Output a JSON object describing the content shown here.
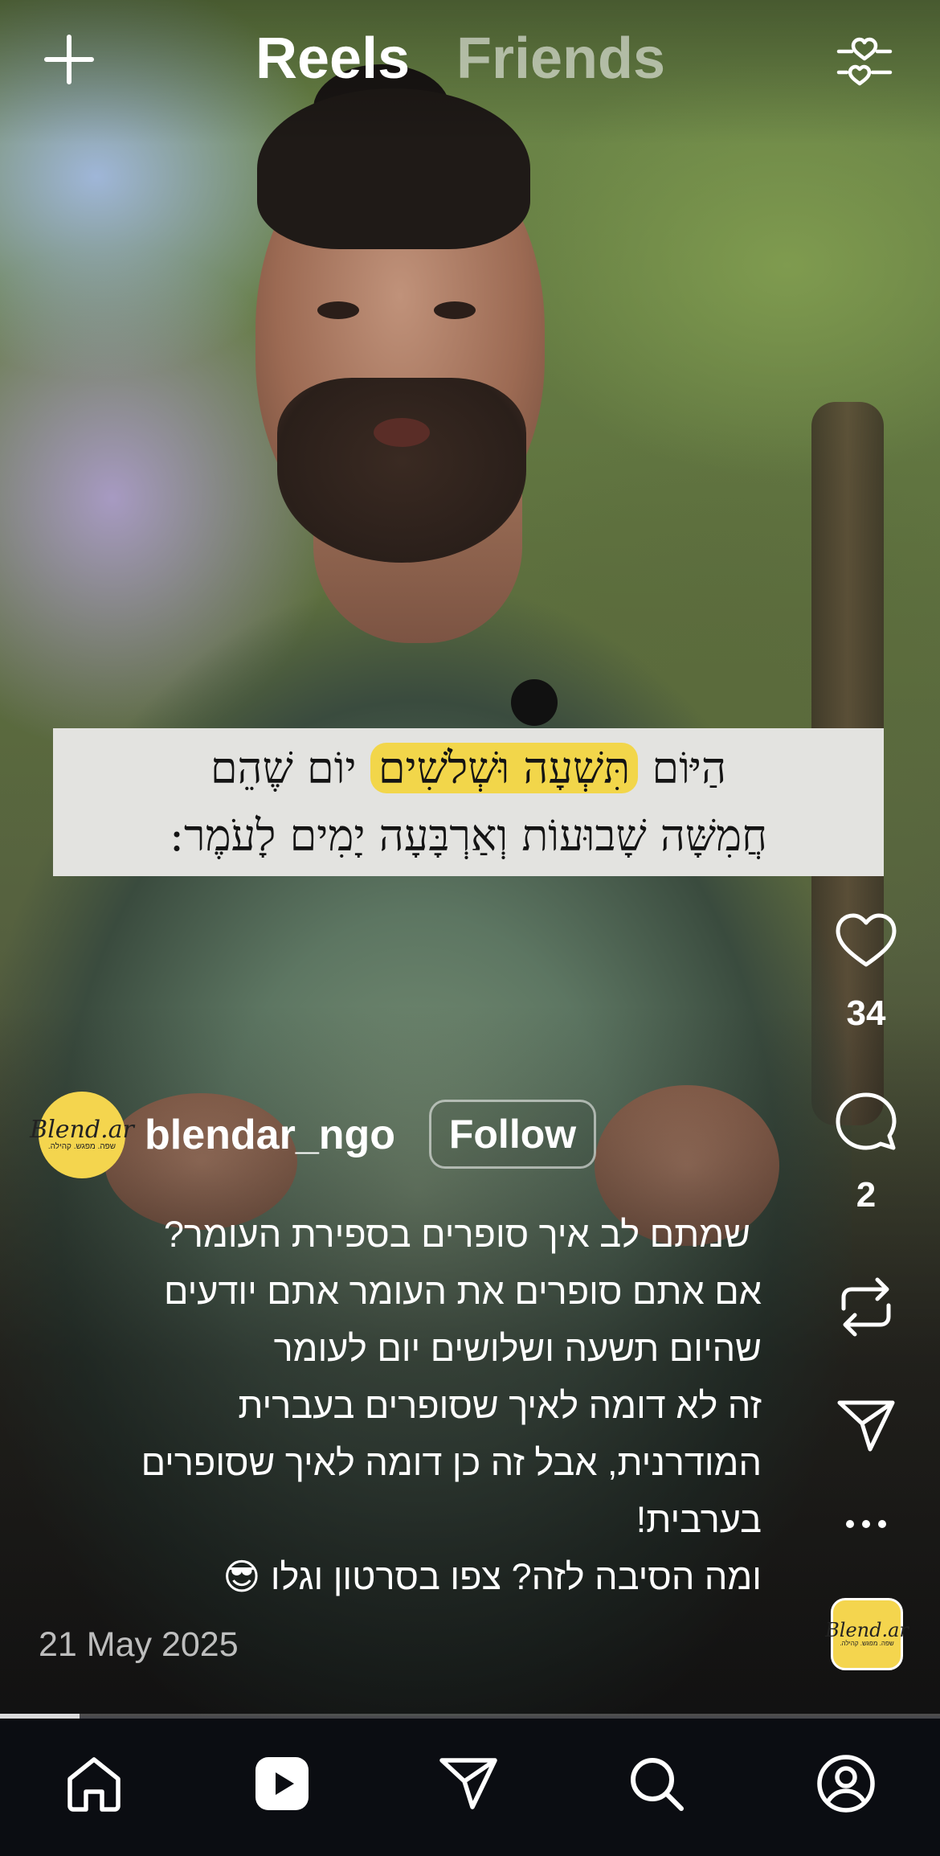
{
  "top_bar": {
    "tabs": [
      {
        "label": "Reels",
        "active": true
      },
      {
        "label": "Friends",
        "active": false
      }
    ],
    "icons": [
      "plus-icon",
      "heart-filter-icon"
    ]
  },
  "video": {
    "overlay_text": {
      "line1_pre": "הַיּוֹם ",
      "line1_highlight": "תִּשְׁעָה וּשְׁלֹשִׁים",
      "line1_post": " יוֹם שֶׁהֵם",
      "line2": "חֲמִשָּׁה שָׁבוּעוֹת וְאַרְבָּעָה יָמִים לָעֹמֶר:",
      "highlight_color": "#f2d64a"
    }
  },
  "actions": {
    "like_count": "34",
    "comment_count": "2",
    "icons": [
      "heart-icon",
      "comment-icon",
      "repost-icon",
      "share-icon",
      "more-icon"
    ]
  },
  "author": {
    "username": "blendar_ngo",
    "follow_label": "Follow",
    "avatar_text": "Blend.ar",
    "avatar_subtext": "שפה. מפגש. קהילה."
  },
  "caption": {
    "lines": [
      "שמתם לב איך סופרים בספירת העומר?",
      "אם אתם סופרים את העומר אתם יודעים",
      "שהיום תשעה ושלושים יום לעומר",
      "זה לא דומה לאיך שסופרים בעברית",
      "המודרנית, אבל זה כן דומה לאיך שסופרים",
      "בערבית!",
      "ומה הסיבה לזה? צפו בסרטון וגלו 😎"
    ],
    "date": "21 May 2025"
  },
  "progress": 0.085,
  "bottom_nav": [
    "home-icon",
    "reels-icon",
    "messages-icon",
    "search-icon",
    "profile-icon"
  ],
  "colors": {
    "accent_yellow": "#f4d54e",
    "nav_bg": "#0b0d12"
  }
}
